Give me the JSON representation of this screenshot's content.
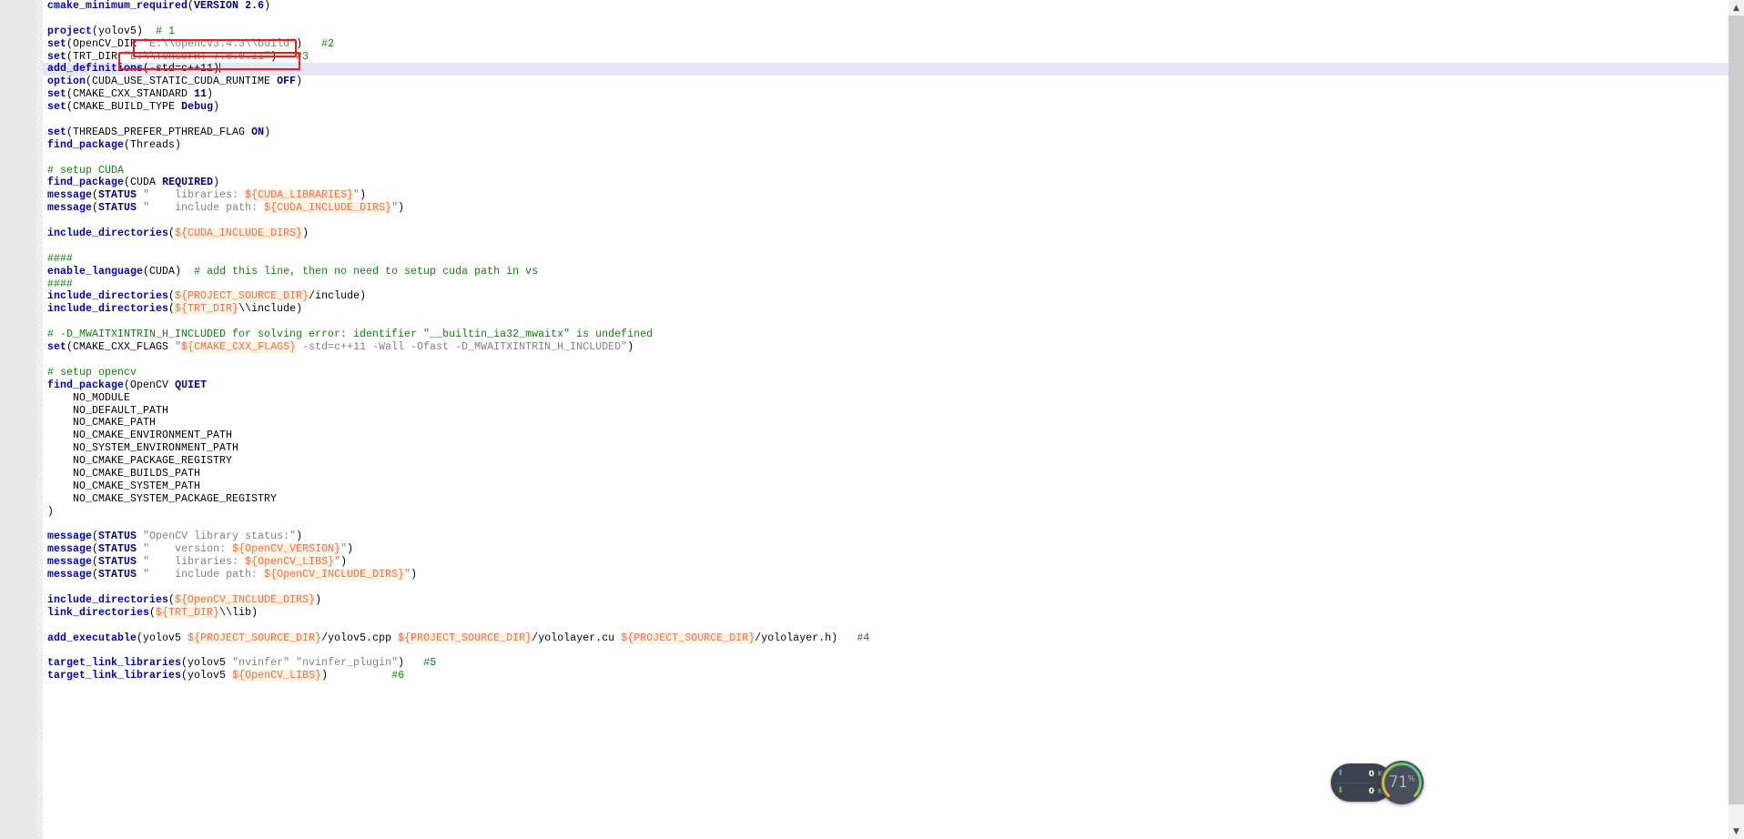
{
  "document": {
    "language": "cmake",
    "current_line": 6,
    "total_visible_lines": 54
  },
  "lines": [
    {
      "n": "1",
      "text": "cmake_minimum_required(VERSION 2.6)"
    },
    {
      "n": "2",
      "text": ""
    },
    {
      "n": "3",
      "text": "project(yolov5)  # 1"
    },
    {
      "n": "4",
      "text": "set(OpenCV_DIR \"E:\\\\opencv3.4.3\\\\build\")   #2"
    },
    {
      "n": "5",
      "text": "set(TRT_DIR \"E:\\\\TensorRT-7.0.0.11\")   #3"
    },
    {
      "n": "6",
      "text": "add_definitions(-std=c++11)"
    },
    {
      "n": "7",
      "text": "option(CUDA_USE_STATIC_CUDA_RUNTIME OFF)"
    },
    {
      "n": "8",
      "text": "set(CMAKE_CXX_STANDARD 11)"
    },
    {
      "n": "9",
      "text": "set(CMAKE_BUILD_TYPE Debug)"
    },
    {
      "n": "10",
      "text": ""
    },
    {
      "n": "11",
      "text": "set(THREADS_PREFER_PTHREAD_FLAG ON)"
    },
    {
      "n": "12",
      "text": "find_package(Threads)"
    },
    {
      "n": "13",
      "text": ""
    },
    {
      "n": "14",
      "text": "# setup CUDA"
    },
    {
      "n": "15",
      "text": "find_package(CUDA REQUIRED)"
    },
    {
      "n": "16",
      "text": "message(STATUS \"    libraries: ${CUDA_LIBRARIES}\")"
    },
    {
      "n": "17",
      "text": "message(STATUS \"    include path: ${CUDA_INCLUDE_DIRS}\")"
    },
    {
      "n": "18",
      "text": ""
    },
    {
      "n": "19",
      "text": "include_directories(${CUDA_INCLUDE_DIRS})"
    },
    {
      "n": "20",
      "text": ""
    },
    {
      "n": "21",
      "text": "####"
    },
    {
      "n": "22",
      "text": "enable_language(CUDA)  # add this line, then no need to setup cuda path in vs"
    },
    {
      "n": "23",
      "text": "####"
    },
    {
      "n": "24",
      "text": "include_directories(${PROJECT_SOURCE_DIR}/include)"
    },
    {
      "n": "25",
      "text": "include_directories(${TRT_DIR}\\\\include)"
    },
    {
      "n": "26",
      "text": ""
    },
    {
      "n": "27",
      "text": "# -D_MWAITXINTRIN_H_INCLUDED for solving error: identifier \"__builtin_ia32_mwaitx\" is undefined"
    },
    {
      "n": "28",
      "text": "set(CMAKE_CXX_FLAGS \"${CMAKE_CXX_FLAGS} -std=c++11 -Wall -Ofast -D_MWAITXINTRIN_H_INCLUDED\")"
    },
    {
      "n": "29",
      "text": ""
    },
    {
      "n": "30",
      "text": "# setup opencv"
    },
    {
      "n": "31",
      "text": "find_package(OpenCV QUIET"
    },
    {
      "n": "32",
      "text": "    NO_MODULE"
    },
    {
      "n": "33",
      "text": "    NO_DEFAULT_PATH"
    },
    {
      "n": "34",
      "text": "    NO_CMAKE_PATH"
    },
    {
      "n": "35",
      "text": "    NO_CMAKE_ENVIRONMENT_PATH"
    },
    {
      "n": "36",
      "text": "    NO_SYSTEM_ENVIRONMENT_PATH"
    },
    {
      "n": "37",
      "text": "    NO_CMAKE_PACKAGE_REGISTRY"
    },
    {
      "n": "38",
      "text": "    NO_CMAKE_BUILDS_PATH"
    },
    {
      "n": "39",
      "text": "    NO_CMAKE_SYSTEM_PATH"
    },
    {
      "n": "40",
      "text": "    NO_CMAKE_SYSTEM_PACKAGE_REGISTRY"
    },
    {
      "n": "41",
      "text": ")"
    },
    {
      "n": "42",
      "text": ""
    },
    {
      "n": "43",
      "text": "message(STATUS \"OpenCV library status:\")"
    },
    {
      "n": "44",
      "text": "message(STATUS \"    version: ${OpenCV_VERSION}\")"
    },
    {
      "n": "45",
      "text": "message(STATUS \"    libraries: ${OpenCV_LIBS}\")"
    },
    {
      "n": "46",
      "text": "message(STATUS \"    include path: ${OpenCV_INCLUDE_DIRS}\")"
    },
    {
      "n": "47",
      "text": ""
    },
    {
      "n": "48",
      "text": "include_directories(${OpenCV_INCLUDE_DIRS})"
    },
    {
      "n": "49",
      "text": "link_directories(${TRT_DIR}\\\\lib)"
    },
    {
      "n": "50",
      "text": ""
    },
    {
      "n": "51",
      "text": "add_executable(yolov5 ${PROJECT_SOURCE_DIR}/yolov5.cpp ${PROJECT_SOURCE_DIR}/yololayer.cu ${PROJECT_SOURCE_DIR}/yololayer.h)   #4"
    },
    {
      "n": "52",
      "text": ""
    },
    {
      "n": "53",
      "text": "target_link_libraries(yolov5 \"nvinfer\" \"nvinfer_plugin\")   #5"
    },
    {
      "n": "54",
      "text": "target_link_libraries(yolov5 ${OpenCV_LIBS})          #6"
    }
  ],
  "annotations": [
    {
      "id": "redbox-opencv-dir",
      "target_line": "4",
      "target_text": "\"E:\\\\opencv3.4.3\\\\build\")",
      "color": "#ee1d1d"
    },
    {
      "id": "redbox-trt-dir",
      "target_line": "5",
      "target_text": "\"E:\\\\TensorRT-7.0.0.11\")   #3",
      "color": "#ee1d1d"
    }
  ],
  "scrollbar": {
    "up_arrow": "▲",
    "down_arrow": "▼"
  },
  "float_widget": {
    "upload": {
      "icon": "arrow-up-icon",
      "glyph": "⬆",
      "value": "0",
      "unit": "K/s",
      "color": "#45a8e8"
    },
    "download": {
      "icon": "arrow-down-icon",
      "glyph": "⬇",
      "value": "0",
      "unit": "K/s",
      "color": "#4fc35a"
    },
    "cpu": {
      "value": "71",
      "unit": "%",
      "ring_colors": [
        "#f0b429",
        "#8fd14f",
        "#35c6a5"
      ]
    }
  }
}
